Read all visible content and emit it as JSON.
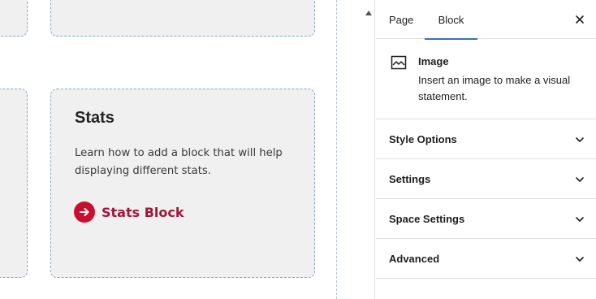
{
  "card": {
    "title": "Stats",
    "description": "Learn how to add a block that will help displaying different stats.",
    "link_label": "Stats Block",
    "accent_color": "#c8102e",
    "link_color": "#a1163a"
  },
  "sidebar": {
    "tabs": [
      {
        "label": "Page",
        "active": false
      },
      {
        "label": "Block",
        "active": true
      }
    ],
    "block": {
      "icon": "image-icon",
      "title": "Image",
      "description": "Insert an image to make a visual statement."
    },
    "panels": [
      {
        "label": "Style Options"
      },
      {
        "label": "Settings"
      },
      {
        "label": "Space Settings"
      },
      {
        "label": "Advanced"
      }
    ],
    "accent_color": "#3b6fb5"
  }
}
